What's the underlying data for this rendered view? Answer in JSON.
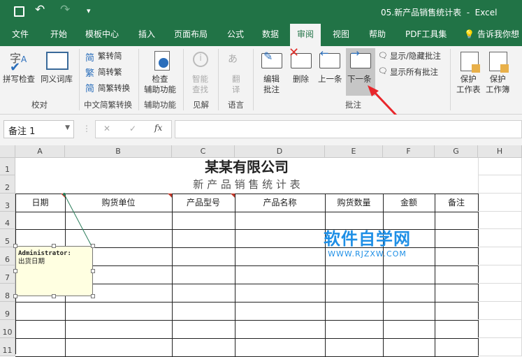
{
  "title": "05.新产品销售统计表  -  Excel",
  "qat": {
    "save": "save-icon",
    "undo": "undo-icon",
    "redo": "redo-icon",
    "customize": "▾"
  },
  "tabs": [
    "文件",
    "开始",
    "模板中心",
    "插入",
    "页面布局",
    "公式",
    "数据",
    "审阅",
    "视图",
    "帮助",
    "PDF工具集"
  ],
  "active_tab": "审阅",
  "tell_me": "告诉我你想",
  "ribbon": {
    "spell": "拼写检查",
    "thesaurus": "同义词库",
    "group_proof": "校对",
    "t2s": "繁转简",
    "s2t": "简转繁",
    "convert": "简繁转换",
    "group_chinese": "中文简繁转换",
    "check1": "检查",
    "check2": "辅助功能",
    "group_access": "辅助功能",
    "smart1": "智能",
    "smart2": "查找",
    "group_insight": "见解",
    "trans1": "翻",
    "trans2": "译",
    "group_lang": "语言",
    "edit1": "编辑",
    "edit2": "批注",
    "delete": "删除",
    "prev": "上一条",
    "next": "下一条",
    "showhide": "显示/隐藏批注",
    "showall": "显示所有批注",
    "group_comment": "批注",
    "protect_sheet1": "保护",
    "protect_sheet2": "工作表",
    "protect_book1": "保护",
    "protect_book2": "工作簿"
  },
  "formula": {
    "namebox": "备注 1",
    "cancel": "✕",
    "enter": "✓",
    "fx": "fx",
    "value": ""
  },
  "columns": [
    "A",
    "B",
    "C",
    "D",
    "E",
    "F",
    "G",
    "H"
  ],
  "rows": [
    "1",
    "2",
    "3",
    "4",
    "5",
    "6",
    "7",
    "8",
    "9",
    "10",
    "11"
  ],
  "sheet": {
    "title": "某某有限公司",
    "subtitle": "新 产 品 销 售 统 计 表",
    "headers": [
      "日期",
      "购货单位",
      "产品型号",
      "产品名称",
      "购货数量",
      "金额",
      "备注"
    ]
  },
  "comment": {
    "author": "Administrator:",
    "text": "出货日期"
  },
  "watermark": {
    "cn": "软件自学网",
    "url": "WWW.RJZXW.COM"
  },
  "colors": {
    "excel_green": "#217346",
    "watermark": "#1e8fe6",
    "arrow": "#e8262b"
  }
}
